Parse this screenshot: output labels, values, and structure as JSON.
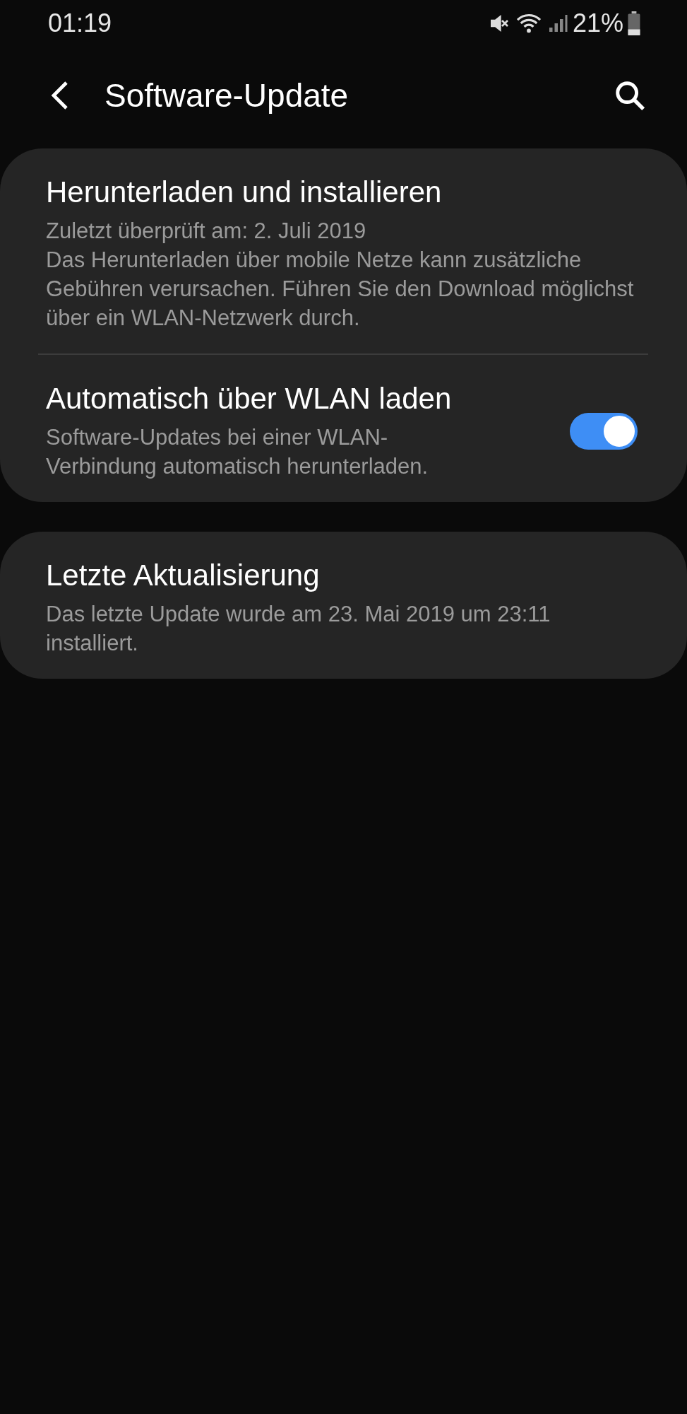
{
  "status_bar": {
    "time": "01:19",
    "battery": "21%"
  },
  "header": {
    "title": "Software-Update"
  },
  "cards": [
    {
      "items": [
        {
          "kind": "text",
          "title": "Herunterladen und installieren",
          "lines": [
            "Zuletzt überprüft am: 2. Juli 2019",
            "Das Herunterladen über mobile Netze kann zusätzliche Gebühren verursachen. Führen Sie den Download möglichst über ein WLAN-Netzwerk durch."
          ]
        },
        {
          "kind": "toggle",
          "title": "Automatisch über WLAN laden",
          "lines": [
            "Software-Updates bei einer WLAN-Verbindung automatisch herunterladen."
          ],
          "on": true
        }
      ]
    },
    {
      "items": [
        {
          "kind": "text",
          "title": "Letzte Aktualisierung",
          "lines": [
            "Das letzte Update wurde am 23. Mai 2019 um 23:11 installiert."
          ]
        }
      ]
    }
  ]
}
